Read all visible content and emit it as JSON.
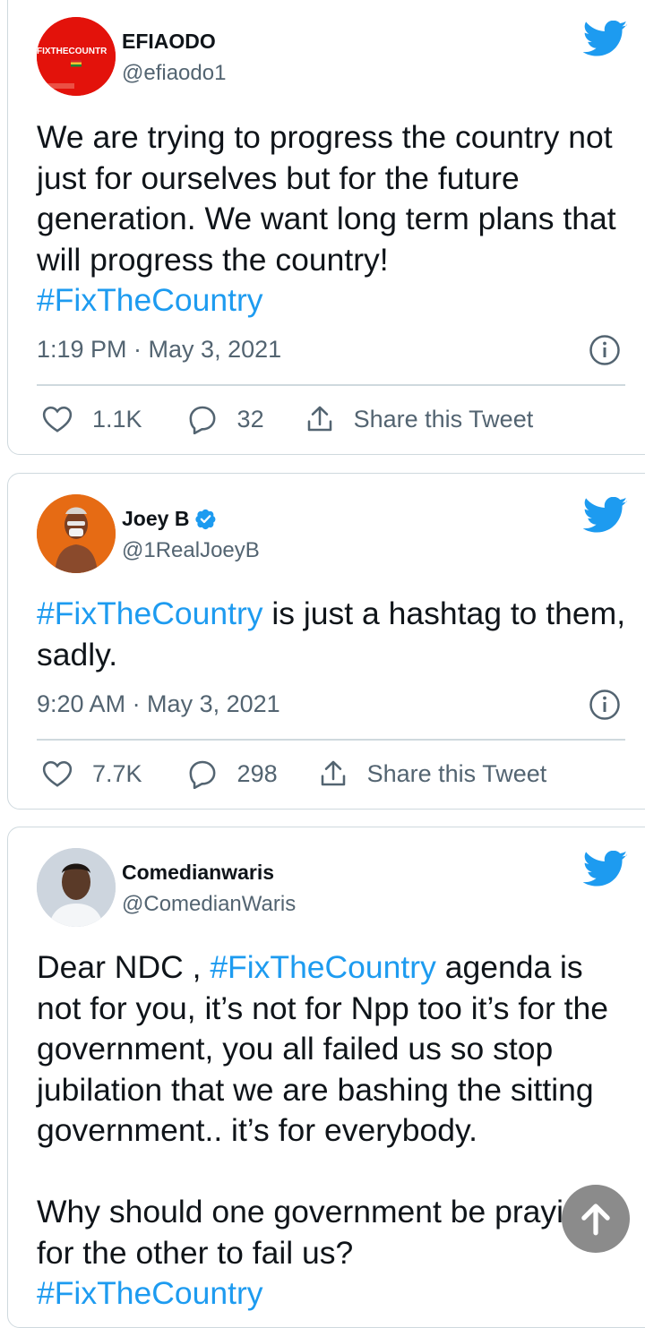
{
  "tweets": [
    {
      "author": "EFIAODO",
      "handle": "@efiaodo1",
      "avatar_text": "FIXTHECOUNTR",
      "verified": false,
      "text": "We are trying to progress the country not just for ourselves but for the future generation.  We want long term plans that will progress the country!",
      "hashtag": "#FixTheCountry",
      "time": "1:19 PM · May 3, 2021",
      "likes": "1.1K",
      "replies": "32",
      "share_label": "Share this Tweet"
    },
    {
      "author": "Joey B",
      "handle": "@1RealJoeyB",
      "verified": true,
      "hashtag": "#FixTheCountry",
      "text": " is just a hashtag to them, sadly.",
      "time": "9:20 AM · May 3, 2021",
      "likes": "7.7K",
      "replies": "298",
      "share_label": "Share this Tweet"
    },
    {
      "author": "Comedianwaris",
      "handle": "@ComedianWaris",
      "verified": false,
      "text_before": "Dear NDC , ",
      "hashtag": "#FixTheCountry",
      "text_after": "  agenda is not for you, it’s not for Npp too it’s for the government, you all failed us so stop jubilation that we are bashing the sitting government.. it’s for everybody.",
      "text_second": "Why should one government be praying for the other to fail us?",
      "hashtag_end": "#FixTheCountry"
    }
  ],
  "colors": {
    "accent": "#1d9bf0",
    "secondary_text": "#536471",
    "border": "#cfd9de",
    "scroll_button": "#8b8b8b"
  },
  "icons": [
    "twitter-bird-icon",
    "info-icon",
    "heart-icon",
    "reply-icon",
    "share-icon",
    "verified-badge-icon",
    "arrow-up-icon"
  ]
}
